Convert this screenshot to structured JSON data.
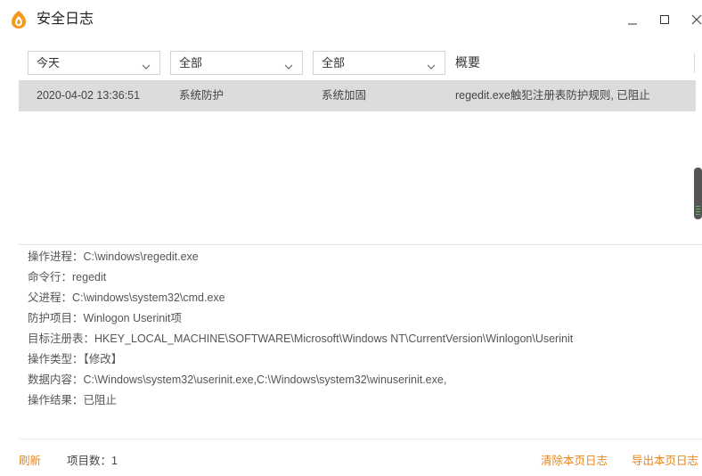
{
  "window": {
    "title": "安全日志"
  },
  "filters": {
    "date": "今天",
    "category": "全部",
    "action": "全部",
    "summary_header": "概要"
  },
  "log_rows": [
    {
      "time": "2020-04-02 13:36:51",
      "category": "系统防护",
      "type": "系统加固",
      "summary": "regedit.exe触犯注册表防护规则, 已阻止"
    }
  ],
  "details": [
    {
      "label": "操作进程：",
      "value": "C:\\windows\\regedit.exe"
    },
    {
      "label": "命令行：",
      "value": "regedit"
    },
    {
      "label": "父进程：",
      "value": "C:\\windows\\system32\\cmd.exe"
    },
    {
      "label": "防护项目：",
      "value": "Winlogon Userinit项"
    },
    {
      "label": "目标注册表：",
      "value": "HKEY_LOCAL_MACHINE\\SOFTWARE\\Microsoft\\Windows NT\\CurrentVersion\\Winlogon\\Userinit"
    },
    {
      "label": "操作类型：",
      "value": "【修改】"
    },
    {
      "label": "数据内容：",
      "value": "C:\\Windows\\system32\\userinit.exe,C:\\Windows\\system32\\winuserinit.exe,"
    },
    {
      "label": "操作结果：",
      "value": "已阻止"
    }
  ],
  "footer": {
    "refresh": "刷新",
    "count_text": "项目数：1",
    "clear": "清除本页日志",
    "export": "导出本页日志"
  },
  "colors": {
    "accent": "#e8861a",
    "selected_row": "#dcdcdc",
    "icon_orange": "#f39a1e"
  },
  "icons": {
    "app": "flame-shield-icon",
    "dropdown": "chevron-down-icon"
  }
}
